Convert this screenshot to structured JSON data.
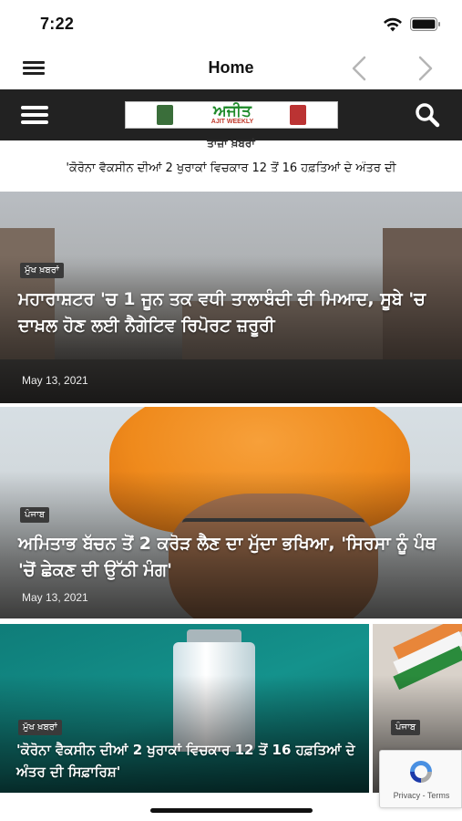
{
  "status_bar": {
    "time": "7:22"
  },
  "nav": {
    "title": "Home"
  },
  "site": {
    "logo_title": "ਅਜੀਤ",
    "logo_subtitle": "AJIT WEEKLY"
  },
  "ticker": {
    "heading": "ਤਾਜ਼ਾ ਖ਼ਬਰਾਂ",
    "text": "'ਕੋਰੋਨਾ ਵੈਕਸੀਨ ਦੀਆਂ 2 ਖੁਰਾਕਾਂ ਵਿਚਕਾਰ 12 ਤੋਂ 16 ਹਫ਼ਤਿਆਂ ਦੇ ਅੰਤਰ ਦੀ"
  },
  "articles": [
    {
      "category": "ਮੁੱਖ ਖ਼ਬਰਾਂ",
      "headline": "ਮਹਾਰਾਸ਼ਟਰ 'ਚ 1 ਜੂਨ ਤਕ ਵਧੀ ਤਾਲਾਬੰਦੀ ਦੀ ਮਿਆਦ, ਸੂਬੇ 'ਚ ਦਾਖ਼ਲ ਹੋਣ ਲਈ ਨੈਗੇਟਿਵ ਰਿਪੋਰਟ ਜ਼ਰੂਰੀ",
      "date": "May 13, 2021"
    },
    {
      "category": "ਪੰਜਾਬ",
      "headline": "ਅਮਿਤਾਭ ਬੱਚਨ ਤੋਂ 2 ਕਰੋੜ ਲੈਣ ਦਾ ਮੁੱਦਾ ਭਖਿਆ, 'ਸਿਰਸਾ ਨੂੰ ਪੰਥ 'ਚੋਂ ਛੇਕਣ ਦੀ ਉੱਠੀ ਮੰਗ'",
      "date": "May 13, 2021"
    },
    {
      "category": "ਮੁੱਖ ਖ਼ਬਰਾਂ",
      "headline": "'ਕੋਰੋਨਾ ਵੈਕਸੀਨ ਦੀਆਂ 2 ਖੁਰਾਕਾਂ ਵਿਚਕਾਰ 12 ਤੋਂ 16 ਹਫ਼ਤਿਆਂ ਦੇ ਅੰਤਰ ਦੀ ਸਿਫ਼ਾਰਿਸ਼'"
    },
    {
      "category": "ਪੰਜਾਬ"
    }
  ],
  "recaptcha": {
    "links": "Privacy - Terms"
  },
  "icons": {
    "nav_menu": "hamburger-icon",
    "back": "chevron-left-icon",
    "forward": "chevron-right-icon",
    "site_menu": "hamburger-icon",
    "search": "search-icon",
    "wifi": "wifi-icon",
    "battery": "battery-icon"
  },
  "colors": {
    "header_bg": "#222222",
    "logo_green": "#1f8a2a",
    "badge_bg": "#3a3a3a"
  }
}
